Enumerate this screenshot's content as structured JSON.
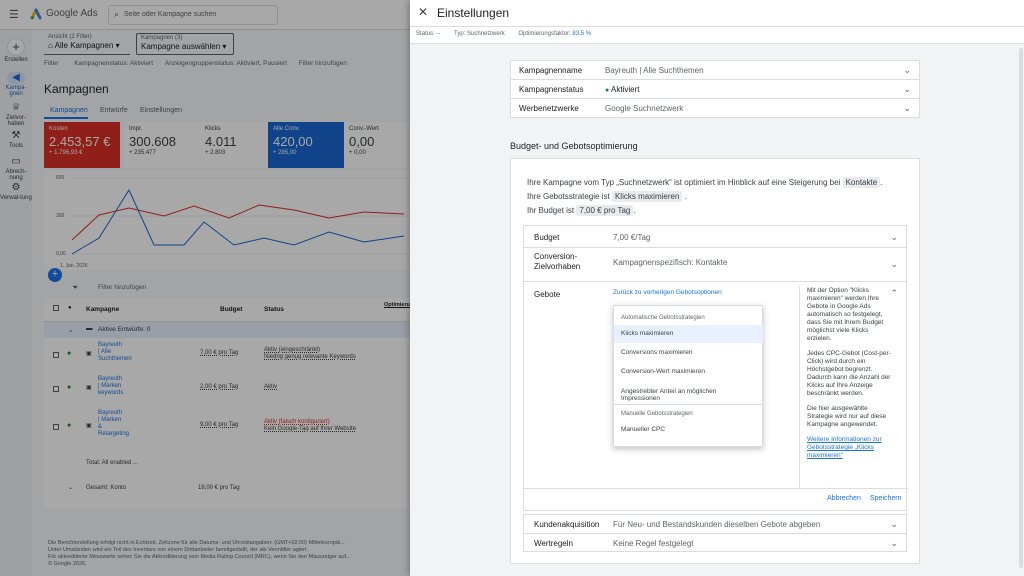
{
  "bg": {
    "app_name": "Google Ads",
    "search_placeholder": "Seite oder Kampagne suchen",
    "view_label": "Ansicht (2 Filter)",
    "view_value": "Alle Kampagnen",
    "campaigns_label": "Kampagnen (3)",
    "campaigns_value": "Kampagne auswählen",
    "filter_label": "Filter",
    "filter_chips": [
      "Kampagnenstatus: Aktiviert",
      "Anzeigengruppenstatus: Aktiviert, Pausiert",
      "Filter hinzufügen"
    ],
    "rail": [
      {
        "label": "Erstellen",
        "icon": "+"
      },
      {
        "label": "Kampa-gnen",
        "icon": "📣"
      },
      {
        "label": "Zielvor-haben",
        "icon": "🏆"
      },
      {
        "label": "Tools",
        "icon": "⚒"
      },
      {
        "label": "Abrech-nung",
        "icon": "▭"
      },
      {
        "label": "Verwal-tung",
        "icon": "⚙"
      }
    ],
    "page_title": "Kampagnen",
    "tabs": [
      "Kampagnen",
      "Entwürfe",
      "Einstellungen"
    ],
    "kpis": [
      {
        "label": "Kosten",
        "value": "2.453,57 €",
        "delta": "+ 1.796,93 €",
        "color": "#d93025"
      },
      {
        "label": "Impr.",
        "value": "300.608",
        "delta": "+ 235.477",
        "color": "#ffffff"
      },
      {
        "label": "Klicks",
        "value": "4.011",
        "delta": "+ 2.803",
        "color": "#ffffff"
      },
      {
        "label": "Alle Conv.",
        "value": "420,00",
        "delta": "+ 285,00",
        "color": "#1967d2"
      },
      {
        "label": "Conv.-Wert",
        "value": "0,00",
        "delta": "+ 0,00",
        "color": "#ffffff"
      }
    ],
    "chart_yticks": [
      "600",
      "300",
      "0,00"
    ],
    "chart_xlabel": "1. Jan. 2026",
    "table_filter": "Filter hinzufügen",
    "table_headers": [
      "Kampagne",
      "Budget",
      "Status",
      "Optimierungsfaktor"
    ],
    "group_row": "Aktive Entwürfe: 0",
    "rows": [
      {
        "name": "Bayreuth | Alle Suchthemen",
        "budget": "7,00 € pro Tag",
        "status": "Aktiv (eingeschränkt)",
        "status2": "Niedrig genug relevante Keywords"
      },
      {
        "name": "Bayreuth | Marken keywords",
        "budget": "2,00 € pro Tag",
        "status": "Aktiv",
        "status2": ""
      },
      {
        "name": "Bayreuth | Marken & Retargeting",
        "budget": "9,00 € pro Tag",
        "status": "Aktiv (falsch konfiguriert)",
        "status2": "Kein Google-Tag auf Ihrer Website"
      }
    ],
    "total_enabled": "Total: All enabled ...",
    "total_account": "Gesamt: Konto",
    "total_budget": "18,00 € pro Tag",
    "footer1": "Die Berichterstellung erfolgt nicht in Echtzeit. Zeitzone für alle Datums- und Uhrzeitangaben: (GMT+02:00) Mitteleuropäi...",
    "footer2": "Unter Umständen wird ein Teil des Inventars von einem Drittanbieter bereitgestellt, der als Vermittler agiert.",
    "footer3": "Für akkreditierte Messwerte sehen Sie die Akkreditierung vom Media Rating Council (MRC), wenn Sie den Mauszeiger auf...",
    "footer4": "© Google 2026."
  },
  "panel": {
    "title": "Einstellungen",
    "status_label": "Status: --",
    "type_label": "Typ: Suchnetzwerk",
    "opt_label": "Optimierungsfaktor:",
    "opt_value": "83,5 %",
    "settings": [
      {
        "key": "Kampagnenname",
        "value": "Bayreuth | Alle Suchthemen"
      },
      {
        "key": "Kampagnenstatus",
        "value": "Aktiviert"
      },
      {
        "key": "Werbenetzwerke",
        "value": "Google Suchnetzwerk"
      }
    ],
    "section_title": "Budget- und Gebotsoptimierung",
    "summary_a": "Ihre Kampagne vom Typ „Suchnetzwerk“ ist optimiert im Hinblick auf eine Steigerung bei",
    "summary_chip1": "Kontakte",
    "summary_b": "Ihre Gebotsstrategie ist",
    "summary_chip2": "Klicks maximieren",
    "summary_c": "Ihr Budget ist",
    "summary_chip3": "7,00 € pro Tag",
    "budget_key": "Budget",
    "budget_value": "7,00 €/Tag",
    "conv_key1": "Conversion-",
    "conv_key2": "Zielvorhaben",
    "conv_value": "Kampagnenspezifisch: Kontakte",
    "gebote_key": "Gebote",
    "back_link": "Zurück zu vorherigen Gebotsoptionen",
    "dropdown": {
      "auto_header": "Automatische Gebotsstrategien",
      "auto_items": [
        "Klicks maximieren",
        "Conversions maximieren",
        "Conversion-Wert maximieren",
        "Angestrebter Anteil an möglichen Impressionen"
      ],
      "manual_header": "Manuelle Gebotsstrategien",
      "manual_items": [
        "Manueller CPC"
      ]
    },
    "help_p1": "Mit der Option \"Klicks maximieren\" werden Ihre Gebote in Google Ads automatisch so festgelegt, dass Sie mit Ihrem Budget möglichst viele Klicks erzielen.",
    "help_p2": "Jedes CPC-Gebot (Cost-per-Click) wird durch ein Höchstgebot begrenzt. Dadurch kann die Anzahl der Klicks auf Ihre Anzeige beschränkt werden.",
    "help_p3": "Die hier ausgewählte Strategie wird nur auf diese Kampagne angewendet.",
    "help_link": "Weitere Informationen zur Gebotsstrategie „Klicks maximieren“",
    "cancel": "Abbrechen",
    "save": "Speichern",
    "kunden_key": "Kundenakquisition",
    "kunden_value": "Für Neu- und Bestandskunden dieselben Gebote abgeben",
    "wert_key": "Wertregeln",
    "wert_value": "Keine Regel festgelegt"
  }
}
